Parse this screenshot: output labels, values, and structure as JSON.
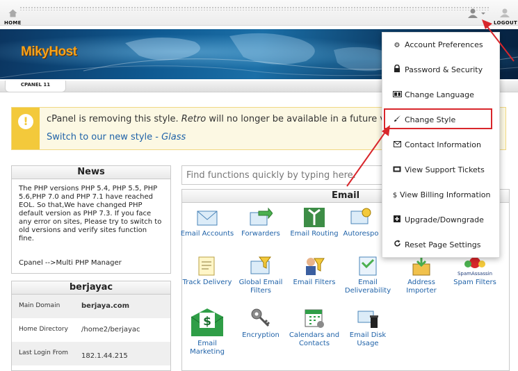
{
  "topbar": {
    "home_label": "HOME",
    "logout_label": "LOGOUT"
  },
  "brand": {
    "name": "MikyHost"
  },
  "subbar": {
    "tab_label": "CPANEL 11"
  },
  "alert": {
    "message_start": "cPanel is removing this style. ",
    "message_style": "Retro",
    "message_end": " will no longer be available in a future versio",
    "link_text": "Switch to our new style - ",
    "link_style": "Glass"
  },
  "news": {
    "title": "News",
    "body": "The PHP versions PHP 5.4, PHP 5.5, PHP 5.6,PHP 7.0 and PHP 7.1 have reached EOL. So that,We have changed PHP default version as PHP 7.3. If you face any error on sites, Please try to switch to old versions and verify sites function fine.",
    "footer": "Cpanel -->Multi PHP Manager"
  },
  "stats": {
    "title": "berjayac",
    "rows": [
      {
        "label": "Main Domain",
        "value": "berjaya.com"
      },
      {
        "label": "Home Directory",
        "value": "/home2/berjayac"
      },
      {
        "label": "Last Login From",
        "value": "182.1.44.215"
      }
    ]
  },
  "search": {
    "placeholder": "Find functions quickly by typing here."
  },
  "email": {
    "title": "Email",
    "apps": [
      {
        "label": "Email Accounts",
        "icon": "email-accounts-icon"
      },
      {
        "label": "Forwarders",
        "icon": "forwarders-icon"
      },
      {
        "label": "Email Routing",
        "icon": "email-routing-icon"
      },
      {
        "label": "Autorespo",
        "icon": "autoresponders-icon"
      },
      {
        "label": "Track Delivery",
        "icon": "track-delivery-icon"
      },
      {
        "label": "Global Email Filters",
        "icon": "global-email-filters-icon"
      },
      {
        "label": "Email Filters",
        "icon": "email-filters-icon"
      },
      {
        "label": "Email Deliverability",
        "icon": "email-deliverability-icon"
      },
      {
        "label": "Address Importer",
        "icon": "address-importer-icon"
      },
      {
        "label": "Spam Filters",
        "icon": "spam-filters-icon"
      },
      {
        "label": "Email Marketing",
        "icon": "email-marketing-icon"
      },
      {
        "label": "Encryption",
        "icon": "encryption-icon"
      },
      {
        "label": "Calendars and Contacts",
        "icon": "calendars-contacts-icon"
      },
      {
        "label": "Email Disk Usage",
        "icon": "email-disk-usage-icon"
      }
    ],
    "spam_badge": "SpamAssassin"
  },
  "dropdown": {
    "items": [
      {
        "label": "Account Preferences",
        "icon": "gears-icon"
      },
      {
        "label": "Password & Security",
        "icon": "lock-icon"
      },
      {
        "label": "Change Language",
        "icon": "language-icon"
      },
      {
        "label": "Change Style",
        "icon": "brush-icon"
      },
      {
        "label": "Contact Information",
        "icon": "envelope-icon"
      },
      {
        "label": "View Support Tickets",
        "icon": "ticket-icon"
      },
      {
        "label": "View Billing Information",
        "icon": "dollar-icon"
      },
      {
        "label": "Upgrade/Downgrade",
        "icon": "plus-square-icon"
      },
      {
        "label": "Reset Page Settings",
        "icon": "refresh-icon"
      }
    ]
  },
  "colors": {
    "link": "#1f62a8",
    "alert_stripe": "#f3c93b",
    "annotation": "#d8262b",
    "brand": "#f6a31b"
  }
}
